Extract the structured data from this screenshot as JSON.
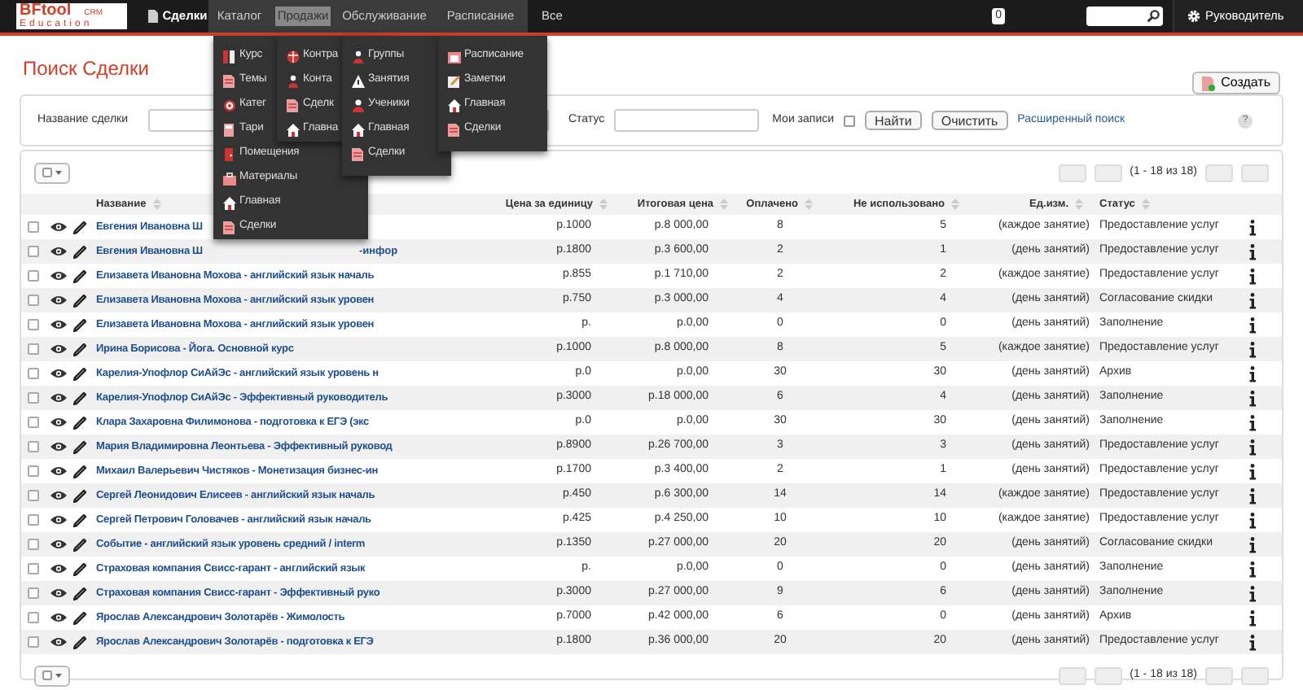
{
  "navbar": {
    "logo": {
      "main": "BFtool",
      "crm": "CRM",
      "sub": "Education"
    },
    "items": [
      {
        "label": "Сделки",
        "kind": "home",
        "open": false,
        "highlighted": false
      },
      {
        "label": "Каталог",
        "kind": "menu",
        "open": true,
        "highlighted": false
      },
      {
        "label": "Продажи",
        "kind": "menu",
        "open": true,
        "highlighted": true
      },
      {
        "label": "Обслуживание",
        "kind": "menu",
        "open": true,
        "highlighted": false
      },
      {
        "label": "Расписание",
        "kind": "menu",
        "open": true,
        "highlighted": false
      },
      {
        "label": "Все",
        "kind": "menu",
        "open": false,
        "highlighted": false
      }
    ],
    "badge": "0",
    "user": "Руководитель"
  },
  "menus": [
    {
      "items": [
        {
          "label": "Курс"
        },
        {
          "label": "Темы"
        },
        {
          "label": "Катег"
        },
        {
          "label": "Тари"
        },
        {
          "label": "Помещения"
        },
        {
          "label": "Материалы"
        },
        {
          "label": "Главная"
        },
        {
          "label": "Сделки"
        }
      ]
    },
    {
      "items": [
        {
          "label": "Контра"
        },
        {
          "label": "Конта"
        },
        {
          "label": "Сделк"
        },
        {
          "label": "Главна"
        }
      ]
    },
    {
      "items": [
        {
          "label": "Группы"
        },
        {
          "label": "Занятия"
        },
        {
          "label": "Ученики"
        },
        {
          "label": "Главная"
        },
        {
          "label": "Сделки"
        }
      ]
    },
    {
      "items": [
        {
          "label": "Расписание"
        },
        {
          "label": "Заметки"
        },
        {
          "label": "Главная"
        },
        {
          "label": "Сделки"
        }
      ]
    }
  ],
  "page_title": "Поиск Сделки",
  "create_button": "Создать",
  "filter": {
    "name_label": "Название сделки",
    "status_label": "Статус",
    "my_records_label": "Мои записи",
    "my_records_checked": false,
    "find_button": "Найти",
    "clear_button": "Очистить",
    "advanced_link": "Расширенный поиск",
    "help": "?"
  },
  "pagination_top": "(1 - 18 из 18)",
  "pagination_bottom": "(1 - 18 из 18)",
  "columns": [
    "Название",
    "Цена за единицу",
    "Итоговая цена",
    "Оплачено",
    "Не использовано",
    "Ед.изм.",
    "Статус"
  ],
  "rows": [
    {
      "checked": false,
      "name": "Евгения Ивановна Ш",
      "unit_price": "р.1000",
      "total": "р.8 000,00",
      "paid": "8",
      "unused": "5",
      "unit": "(каждое занятие)",
      "status": "Предоставление услуг"
    },
    {
      "checked": false,
      "name": "Евгения Ивановна Ш",
      "name_tail": "-инфор",
      "unit_price": "р.1800",
      "total": "р.3 600,00",
      "paid": "2",
      "unused": "1",
      "unit": "(день занятий)",
      "status": "Предоставление услуг"
    },
    {
      "checked": false,
      "name": "Елизавета Ивановна Мохова - английский язык началь",
      "unit_price": "р.855",
      "total": "р.1 710,00",
      "paid": "2",
      "unused": "2",
      "unit": "(каждое занятие)",
      "status": "Предоставление услуг"
    },
    {
      "checked": false,
      "name": "Елизавета Ивановна Мохова - английский язык уровен",
      "unit_price": "р.750",
      "total": "р.3 000,00",
      "paid": "4",
      "unused": "4",
      "unit": "(день занятий)",
      "status": "Согласование скидки"
    },
    {
      "checked": false,
      "name": "Елизавета Ивановна Мохова - английский язык уровен",
      "unit_price": "р.",
      "total": "р.0,00",
      "paid": "0",
      "unused": "0",
      "unit": "(день занятий)",
      "status": "Заполнение"
    },
    {
      "checked": false,
      "name": "Ирина Борисова - Йога. Основной курс",
      "unit_price": "р.1000",
      "total": "р.8 000,00",
      "paid": "8",
      "unused": "5",
      "unit": "(каждое занятие)",
      "status": "Предоставление услуг"
    },
    {
      "checked": false,
      "name": "Карелия-Упофлор СиАйЭс - английский язык уровень н",
      "unit_price": "р.0",
      "total": "р.0,00",
      "paid": "30",
      "unused": "30",
      "unit": "(день занятий)",
      "status": "Архив"
    },
    {
      "checked": false,
      "name": "Карелия-Упофлор СиАйЭс - Эффективный руководитель",
      "unit_price": "р.3000",
      "total": "р.18 000,00",
      "paid": "6",
      "unused": "4",
      "unit": "(день занятий)",
      "status": "Заполнение"
    },
    {
      "checked": false,
      "name": "Клара Захаровна Филимонова - подготовка к ЕГЭ (экс",
      "unit_price": "р.0",
      "total": "р.0,00",
      "paid": "30",
      "unused": "30",
      "unit": "(день занятий)",
      "status": "Заполнение"
    },
    {
      "checked": false,
      "name": "Мария Владимировна Леонтьева - Эффективный руковод",
      "unit_price": "р.8900",
      "total": "р.26 700,00",
      "paid": "3",
      "unused": "3",
      "unit": "(день занятий)",
      "status": "Предоставление услуг"
    },
    {
      "checked": false,
      "name": "Михаил Валерьевич Чистяков - Монетизация бизнес-ин",
      "unit_price": "р.1700",
      "total": "р.3 400,00",
      "paid": "2",
      "unused": "1",
      "unit": "(день занятий)",
      "status": "Предоставление услуг"
    },
    {
      "checked": false,
      "name": "Сергей Леонидович Елисеев - английский язык началь",
      "unit_price": "р.450",
      "total": "р.6 300,00",
      "paid": "14",
      "unused": "14",
      "unit": "(каждое занятие)",
      "status": "Предоставление услуг"
    },
    {
      "checked": false,
      "name": "Сергей Петрович Головачев - английский язык началь",
      "unit_price": "р.425",
      "total": "р.4 250,00",
      "paid": "10",
      "unused": "10",
      "unit": "(каждое занятие)",
      "status": "Предоставление услуг"
    },
    {
      "checked": false,
      "name": "Событие - английский язык уровень средний / interm",
      "unit_price": "р.1350",
      "total": "р.27 000,00",
      "paid": "20",
      "unused": "20",
      "unit": "(день занятий)",
      "status": "Согласование скидки"
    },
    {
      "checked": false,
      "name": "Страховая компания Свисс-гарант - английский язык",
      "unit_price": "р.",
      "total": "р.0,00",
      "paid": "0",
      "unused": "0",
      "unit": "(день занятий)",
      "status": "Заполнение"
    },
    {
      "checked": false,
      "name": "Страховая компания Свисс-гарант - Эффективный руко",
      "unit_price": "р.3000",
      "total": "р.27 000,00",
      "paid": "9",
      "unused": "6",
      "unit": "(день занятий)",
      "status": "Заполнение"
    },
    {
      "checked": false,
      "name": "Ярослав Александрович Золотарёв - Жимолость",
      "unit_price": "р.7000",
      "total": "р.42 000,00",
      "paid": "6",
      "unused": "0",
      "unit": "(день занятий)",
      "status": "Архив"
    },
    {
      "checked": false,
      "name": "Ярослав Александрович Золотарёв - подготовка к ЕГЭ",
      "unit_price": "р.1800",
      "total": "р.36 000,00",
      "paid": "20",
      "unused": "20",
      "unit": "(день занятий)",
      "status": "Предоставление услуг"
    }
  ]
}
